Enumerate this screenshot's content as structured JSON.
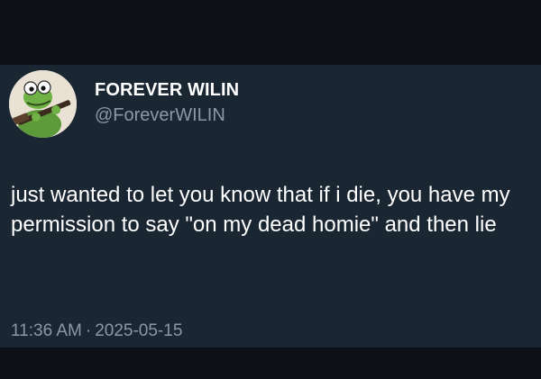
{
  "tweet": {
    "author": {
      "display_name": "FOREVER WILIN",
      "handle": "@ForeverWILIN",
      "avatar_icon": "frog-with-rifle-avatar"
    },
    "text": "just wanted to let you know that if i die, you have my permission to say \"on my dead homie\" and then lie",
    "time": "11:36 AM",
    "separator": "·",
    "date": "2025-05-15"
  },
  "colors": {
    "page_background": "#0d1117",
    "card_background": "#1b2633",
    "primary_text": "#ffffff",
    "secondary_text": "#8b98a5"
  }
}
